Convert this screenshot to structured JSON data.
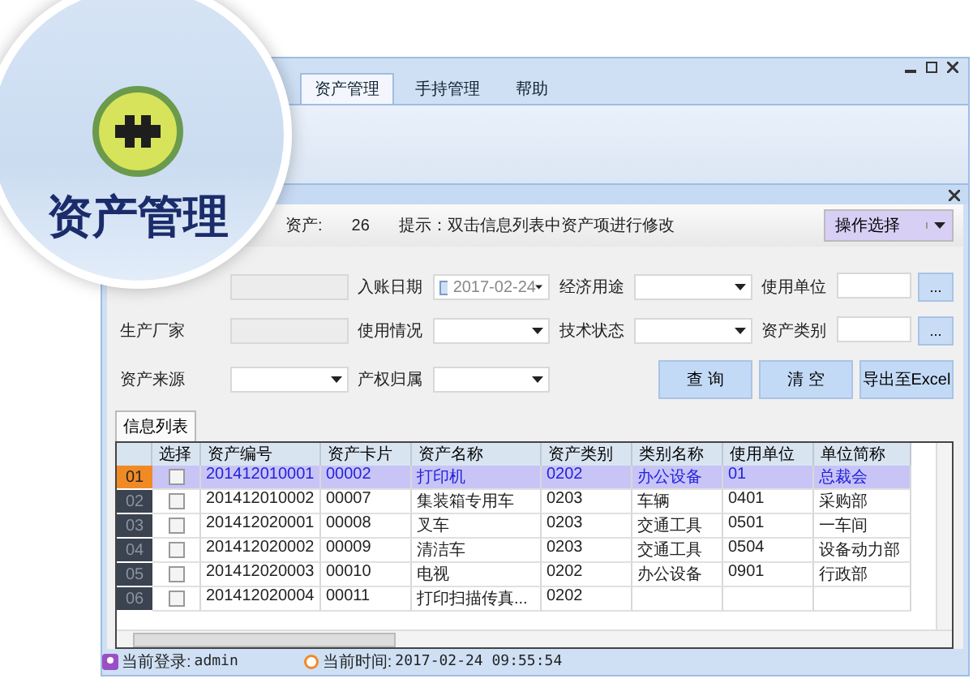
{
  "magnifier": {
    "label": "资产管理"
  },
  "menu_tabs": [
    {
      "label": "资产管理",
      "selected": true
    },
    {
      "label": "手持管理",
      "selected": false
    },
    {
      "label": "帮助",
      "selected": false
    }
  ],
  "info_bar": {
    "count_label": "资产:",
    "count": "26",
    "hint": "提示：双击信息列表中资产项进行修改",
    "action": "操作选择"
  },
  "filters": [
    {
      "kind": "text"
    },
    {
      "kind": "date",
      "label": "入账日期",
      "value": "2017-02-24"
    },
    {
      "kind": "select",
      "label": "经济用途"
    },
    {
      "kind": "picker",
      "label": "使用单位",
      "button": "..."
    },
    {
      "kind": "text",
      "label": "生产厂家"
    },
    {
      "kind": "select",
      "label": "使用情况"
    },
    {
      "kind": "select",
      "label": "技术状态"
    },
    {
      "kind": "picker",
      "label": "资产类别",
      "button": "..."
    },
    {
      "kind": "select",
      "label": "资产来源"
    },
    {
      "kind": "select",
      "label": "产权归属"
    }
  ],
  "buttons": [
    "查 询",
    "清 空",
    "导出至Excel"
  ],
  "list_tab": {
    "label": "信息列表"
  },
  "table": {
    "columns": [
      "",
      "选择",
      "资产编号",
      "资产卡片",
      "资产名称",
      "资产类别",
      "类别名称",
      "使用单位",
      "单位简称"
    ],
    "rows": [
      {
        "selected": true,
        "checked": false,
        "cells": [
          "01",
          "",
          "201412010001",
          "00002",
          "打印机",
          "0202",
          "办公设备",
          "01",
          "总裁会"
        ]
      },
      {
        "selected": false,
        "checked": false,
        "cells": [
          "02",
          "",
          "201412010002",
          "00007",
          "集装箱专用车",
          "0203",
          "车辆",
          "0401",
          "采购部"
        ]
      },
      {
        "selected": false,
        "checked": false,
        "cells": [
          "03",
          "",
          "201412020001",
          "00008",
          "叉车",
          "0203",
          "交通工具",
          "0501",
          "一车间"
        ]
      },
      {
        "selected": false,
        "checked": false,
        "cells": [
          "04",
          "",
          "201412020002",
          "00009",
          "清洁车",
          "0203",
          "交通工具",
          "0504",
          "设备动力部"
        ]
      },
      {
        "selected": false,
        "checked": false,
        "cells": [
          "05",
          "",
          "201412020003",
          "00010",
          "电视",
          "0202",
          "办公设备",
          "0901",
          "行政部"
        ]
      },
      {
        "selected": false,
        "checked": false,
        "cells": [
          "06",
          "",
          "201412020004",
          "00011",
          "打印扫描传真...",
          "0202",
          "",
          "",
          ""
        ]
      }
    ]
  },
  "status_bar": {
    "login_label": "当前登录:",
    "login": "admin",
    "time_label": "当前时间:",
    "time": "2017-02-24 09:55:54"
  }
}
